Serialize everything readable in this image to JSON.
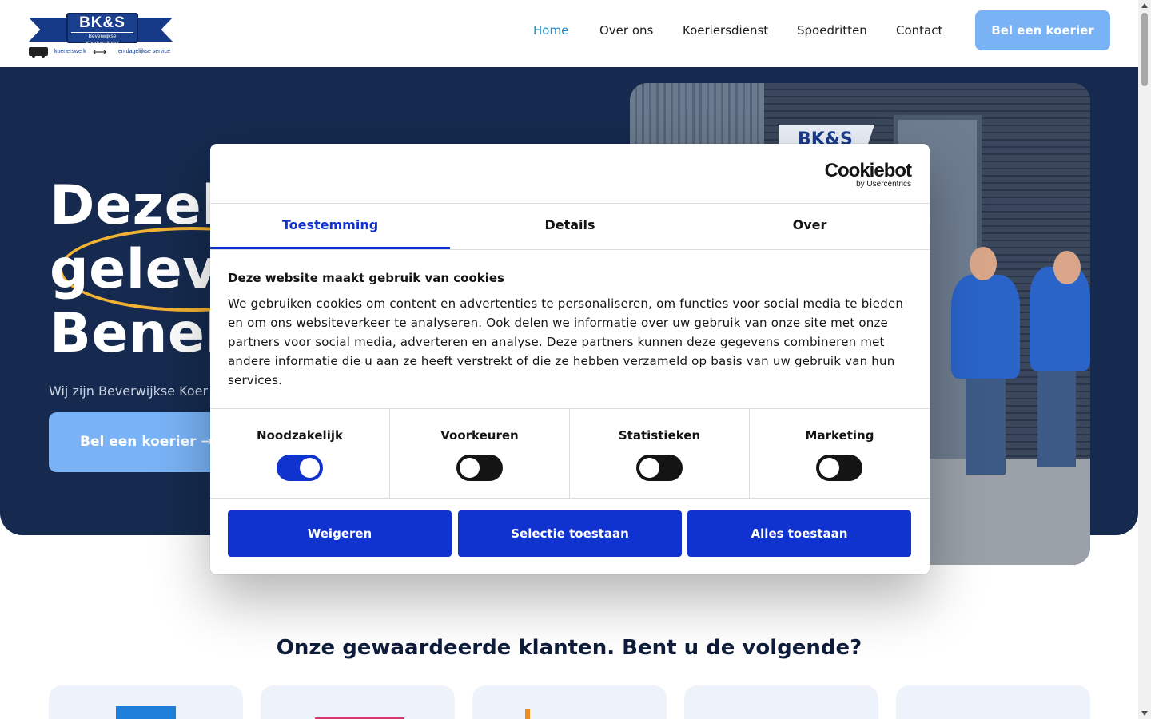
{
  "header": {
    "logo": {
      "name": "BK&S",
      "subtitle": "Beverwijkse Koeriersdienst",
      "tagline_left": "koerierswerk",
      "tagline_right": "en dagelijkse service"
    },
    "nav": [
      {
        "label": "Home",
        "active": true
      },
      {
        "label": "Over ons",
        "active": false
      },
      {
        "label": "Koeriersdienst",
        "active": false
      },
      {
        "label": "Spoedritten",
        "active": false
      },
      {
        "label": "Contact",
        "active": false
      }
    ],
    "cta_label": "Bel een koerier"
  },
  "hero": {
    "title_lines": [
      "Dezel",
      "geleve",
      "Benel"
    ],
    "subtitle": "Wij zijn Beverwijkse Koer",
    "cta_label": "Bel een koerier →",
    "photo_sign_text": "BK&S"
  },
  "clients": {
    "title": "Onze gewaardeerde klanten. Bent u de volgende?"
  },
  "cookie_dialog": {
    "brand": "Cookiebot",
    "brand_sub": "by Usercentrics",
    "tabs": [
      {
        "label": "Toestemming",
        "active": true
      },
      {
        "label": "Details",
        "active": false
      },
      {
        "label": "Over",
        "active": false
      }
    ],
    "heading": "Deze website maakt gebruik van cookies",
    "body": "We gebruiken cookies om content en advertenties te personaliseren, om functies voor social media te bieden en om ons websiteverkeer te analyseren. Ook delen we informatie over uw gebruik van onze site met onze partners voor social media, adverteren en analyse. Deze partners kunnen deze gegevens combineren met andere informatie die u aan ze heeft verstrekt of die ze hebben verzameld op basis van uw gebruik van hun services.",
    "toggles": [
      {
        "label": "Noodzakelijk",
        "on": true
      },
      {
        "label": "Voorkeuren",
        "on": false
      },
      {
        "label": "Statistieken",
        "on": false
      },
      {
        "label": "Marketing",
        "on": false
      }
    ],
    "buttons": {
      "reject": "Weigeren",
      "selection": "Selectie toestaan",
      "accept_all": "Alles toestaan"
    }
  },
  "colors": {
    "hero_bg": "#152a4e",
    "accent_light_blue": "#79b3f6",
    "cookie_blue": "#1032cf",
    "nav_active": "#1f8bcf",
    "highlight_yellow": "#f2b233"
  }
}
